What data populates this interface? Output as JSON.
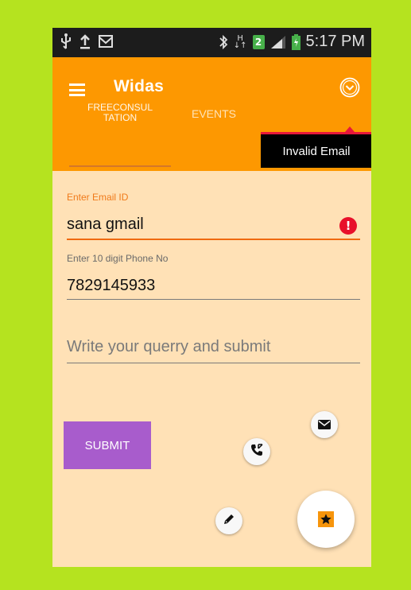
{
  "status_bar": {
    "time": "5:17 PM",
    "network_badge": "2",
    "network_type": "H",
    "icons": [
      "usb-icon",
      "upload-icon",
      "mail-icon",
      "bluetooth-icon",
      "signal-icon",
      "battery-charging-icon"
    ]
  },
  "app_bar": {
    "title": "Widas",
    "menu_icon": "hamburger-menu-icon",
    "overflow_icon": "chevron-down-circle-icon",
    "background_color": "#fd9801"
  },
  "tabs": [
    {
      "label": "FREECONSUL\nTATION",
      "selected": true
    },
    {
      "label": "EVENTS",
      "selected": false
    }
  ],
  "toast": {
    "message": "Invalid Email"
  },
  "form": {
    "email": {
      "label": "Enter Email ID",
      "value": "sana gmail",
      "error": true,
      "error_icon": "alert-circle-icon"
    },
    "phone": {
      "label": "Enter 10 digit Phone No",
      "value": "7829145933"
    },
    "query": {
      "placeholder": "Write your querry and submit",
      "value": ""
    }
  },
  "submit": {
    "label": "SUBMIT",
    "color": "#a85ccc"
  },
  "fab_menu": {
    "main_icon": "star-icon",
    "items": [
      "mail-icon",
      "phone-icon",
      "pencil-icon"
    ]
  },
  "colors": {
    "page_background": "#b5e31f",
    "content_background": "#ffe1b6",
    "error": "#e8102a",
    "accent": "#f07a1a"
  }
}
